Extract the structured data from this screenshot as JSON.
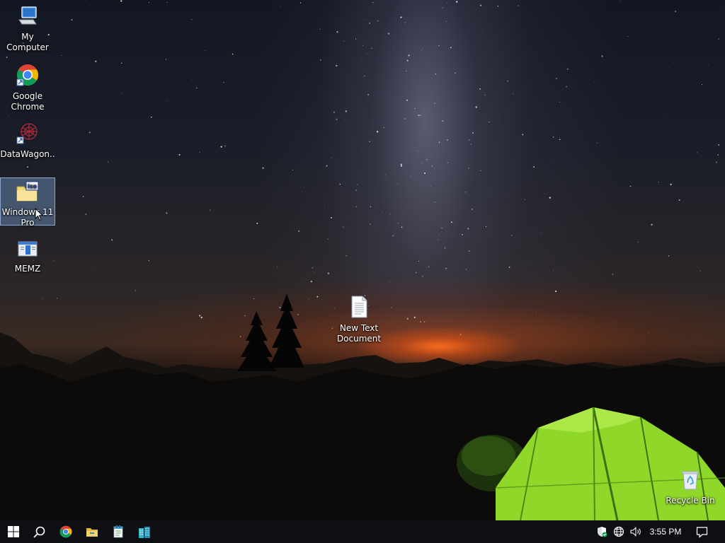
{
  "desktop": {
    "icons": [
      {
        "label": "My Computer",
        "icon": "computer-icon"
      },
      {
        "label": "Google Chrome",
        "icon": "chrome-icon"
      },
      {
        "label": "DataWagon...",
        "icon": "datawagon-icon"
      },
      {
        "label": "Windows 11 Pro",
        "icon": "iso-file-icon",
        "selected": true,
        "badge": "iso"
      },
      {
        "label": "MEMZ",
        "icon": "memz-icon"
      },
      {
        "label": "New Text Document",
        "icon": "text-document-icon"
      },
      {
        "label": "Recycle Bin",
        "icon": "recycle-bin-icon"
      }
    ]
  },
  "taskbar": {
    "pinned": [
      {
        "icon": "windows-start-icon"
      },
      {
        "icon": "search-icon"
      },
      {
        "icon": "chrome-icon"
      },
      {
        "icon": "file-explorer-icon"
      },
      {
        "icon": "notepad-icon"
      },
      {
        "icon": "buildings-app-icon"
      }
    ],
    "tray": {
      "icons": [
        "security-shield-icon",
        "network-globe-icon",
        "volume-icon",
        "notification-icon"
      ],
      "time": "3:55 PM"
    }
  },
  "colors": {
    "taskbar": "#0d0f12",
    "selection": "#78a0d2",
    "tent": "#8fd82a"
  }
}
